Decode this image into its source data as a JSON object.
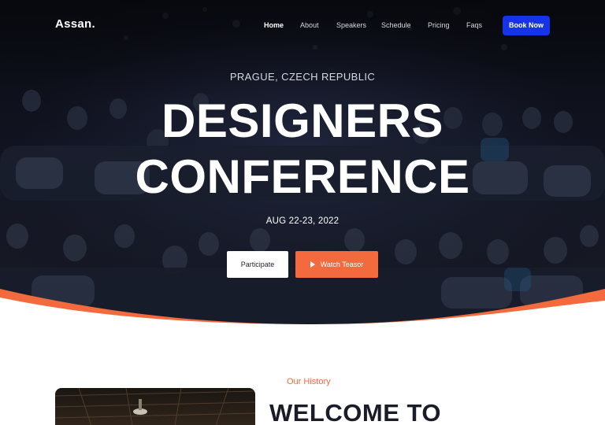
{
  "brand": {
    "logo": "Assan."
  },
  "nav": {
    "items": [
      {
        "label": "Home",
        "active": true
      },
      {
        "label": "About",
        "active": false
      },
      {
        "label": "Speakers",
        "active": false
      },
      {
        "label": "Schedule",
        "active": false
      },
      {
        "label": "Pricing",
        "active": false
      },
      {
        "label": "Faqs",
        "active": false
      }
    ],
    "cta": "Book Now"
  },
  "hero": {
    "location": "PRAGUE, CZECH REPUBLIC",
    "title_line1": "DESIGNERS",
    "title_line2": "CONFERENCE",
    "date": "AUG 22-23, 2022",
    "primary_button": "Participate",
    "secondary_button": "Watch Teasor",
    "secondary_icon": "play-icon"
  },
  "history": {
    "eyebrow": "Our History",
    "heading": "WELCOME TO"
  },
  "colors": {
    "accent": "#f26a3d",
    "brand_blue": "#1733ea",
    "heading_dark": "#1a1d29",
    "hero_dark": "#121522"
  }
}
